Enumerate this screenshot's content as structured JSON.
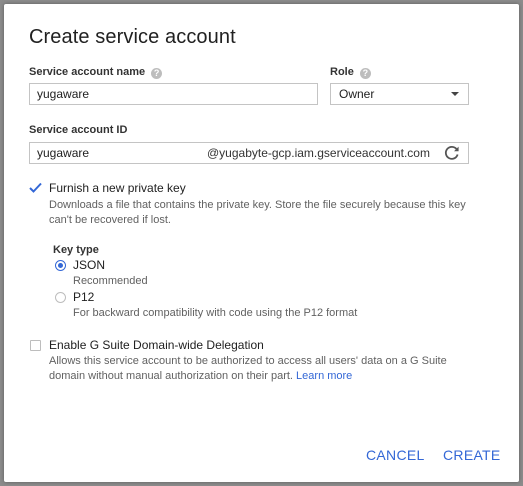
{
  "dialog": {
    "title": "Create service account",
    "service_account_name": {
      "label": "Service account name",
      "value": "yugaware"
    },
    "role": {
      "label": "Role",
      "selected": "Owner"
    },
    "service_account_id": {
      "label": "Service account ID",
      "value": "yugaware",
      "suffix": "@yugabyte-gcp.iam.gserviceaccount.com"
    },
    "private_key": {
      "label": "Furnish a new private key",
      "checked": true,
      "desc_line1": "Downloads a file that contains the private key. Store the file securely because this key",
      "desc_line2": "can't be recovered if lost.",
      "key_type_label": "Key type",
      "options": [
        {
          "label": "JSON",
          "desc": "Recommended",
          "selected": true
        },
        {
          "label": "P12",
          "desc": "For backward compatibility with code using the P12 format",
          "selected": false
        }
      ]
    },
    "delegation": {
      "label": "Enable G Suite Domain-wide Delegation",
      "checked": false,
      "desc_line1": "Allows this service account to be authorized to access all users' data on a G Suite",
      "desc_line2": "domain without manual authorization on their part.",
      "learn_more": "Learn more"
    },
    "buttons": {
      "cancel": "CANCEL",
      "create": "CREATE"
    },
    "colors": {
      "accent": "#3367d6",
      "overlay": "#8c8c8c"
    }
  }
}
